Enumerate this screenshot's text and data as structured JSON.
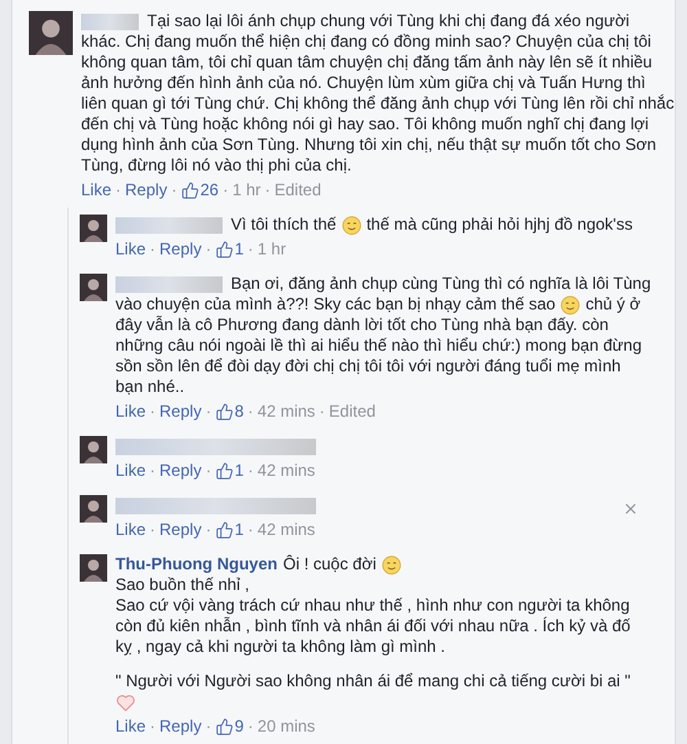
{
  "comment": {
    "lines": [
      [
        {
          "kind": "blur"
        },
        {
          "kind": "text",
          "text": "Tại sao lại lôi ánh chụp chung với Tùng khi chị đang đá xéo người"
        }
      ],
      [
        {
          "kind": "text",
          "text": "khác. Chị đang muốn thể hiện chị đang có đồng minh sao? Chuyện của chị tôi"
        }
      ],
      [
        {
          "kind": "text",
          "text": "không quan tâm, tôi chỉ quan tâm chuyện chị đăng tấm ảnh này lên sẽ ít nhiều"
        }
      ],
      [
        {
          "kind": "text",
          "text": "ảnh hưởng đến hình ảnh của nó. Chuyện lùm xùm giữa chị và Tuấn Hưng thì"
        }
      ],
      [
        {
          "kind": "text",
          "text": "liên quan gì tới Tùng chứ. Chị không thể đăng ảnh chụp với Tùng lên rồi chỉ nhắc"
        }
      ],
      [
        {
          "kind": "text",
          "text": "đến chị và Tùng hoặc không nói gì hay sao. Tôi không muốn nghĩ chị đang lợi"
        }
      ],
      [
        {
          "kind": "text",
          "text": "dụng hình ảnh của Sơn Tùng. Nhưng tôi xin chị, nếu thật sự muốn tốt cho Sơn"
        }
      ],
      [
        {
          "kind": "text",
          "text": "Tùng, đừng lôi nó vào thị phi của chị."
        }
      ]
    ],
    "footer": [
      {
        "kind": "link",
        "text": "Like"
      },
      {
        "kind": "sep",
        "text": "·"
      },
      {
        "kind": "link",
        "text": "Reply"
      },
      {
        "kind": "sep",
        "text": "·"
      },
      {
        "kind": "likes",
        "text": "26"
      },
      {
        "kind": "sep",
        "text": "·"
      },
      {
        "kind": "time",
        "text": "1 hr"
      },
      {
        "kind": "sep",
        "text": "·"
      },
      {
        "kind": "plain",
        "text": "Edited"
      }
    ]
  },
  "replies": [
    {
      "lines": [
        [
          {
            "kind": "blur"
          },
          {
            "kind": "text",
            "text": "Vì tôi thích thế"
          },
          {
            "kind": "emoji"
          },
          {
            "kind": "text",
            "text": "thế mà cũng phải hỏi hjhj đồ ngok'ss"
          }
        ]
      ],
      "footer": [
        {
          "kind": "link",
          "text": "Like"
        },
        {
          "kind": "sep",
          "text": "·"
        },
        {
          "kind": "link",
          "text": "Reply"
        },
        {
          "kind": "sep",
          "text": "·"
        },
        {
          "kind": "likes",
          "text": "1"
        },
        {
          "kind": "sep",
          "text": "·"
        },
        {
          "kind": "time",
          "text": "1 hr"
        }
      ]
    },
    {
      "lines": [
        [
          {
            "kind": "blur"
          },
          {
            "kind": "text",
            "text": "Bạn ơi, đăng ảnh chụp cùng Tùng thì có nghĩa là lôi Tùng"
          }
        ],
        [
          {
            "kind": "text",
            "text": "vào chuyện của mình à??! Sky các bạn bị nhạy cảm thế sao"
          },
          {
            "kind": "emoji"
          },
          {
            "kind": "text",
            "text": "chủ ý ở"
          }
        ],
        [
          {
            "kind": "text",
            "text": "đây vẫn là cô Phương đang dành lời tốt cho Tùng nhà bạn đấy. còn"
          }
        ],
        [
          {
            "kind": "text",
            "text": "những câu nói ngoài lề thì ai hiểu thế nào thì hiểu chứ:) mong bạn đừng"
          }
        ],
        [
          {
            "kind": "text",
            "text": "sồn sồn lên để đòi dạy đời chị chị tôi tôi với người đáng tuổi mẹ mình"
          }
        ],
        [
          {
            "kind": "text",
            "text": "bạn nhé.."
          }
        ]
      ],
      "footer": [
        {
          "kind": "link",
          "text": "Like"
        },
        {
          "kind": "sep",
          "text": "·"
        },
        {
          "kind": "link",
          "text": "Reply"
        },
        {
          "kind": "sep",
          "text": "·"
        },
        {
          "kind": "likes",
          "text": "8"
        },
        {
          "kind": "sep",
          "text": "·"
        },
        {
          "kind": "time",
          "text": "42 mins"
        },
        {
          "kind": "sep",
          "text": "·"
        },
        {
          "kind": "plain",
          "text": "Edited"
        }
      ]
    },
    {
      "footer": [
        {
          "kind": "link",
          "text": "Like"
        },
        {
          "kind": "sep",
          "text": "·"
        },
        {
          "kind": "link",
          "text": "Reply"
        },
        {
          "kind": "sep",
          "text": "·"
        },
        {
          "kind": "likes",
          "text": "1"
        },
        {
          "kind": "sep",
          "text": "·"
        },
        {
          "kind": "time",
          "text": "42 mins"
        }
      ]
    },
    {
      "closable": true,
      "footer": [
        {
          "kind": "link",
          "text": "Like"
        },
        {
          "kind": "sep",
          "text": "·"
        },
        {
          "kind": "link",
          "text": "Reply"
        },
        {
          "kind": "sep",
          "text": "·"
        },
        {
          "kind": "likes",
          "text": "1"
        },
        {
          "kind": "sep",
          "text": "·"
        },
        {
          "kind": "time",
          "text": "42 mins"
        }
      ]
    },
    {
      "lines": [
        [
          {
            "kind": "author",
            "text": "Thu-Phuong Nguyen"
          },
          {
            "kind": "text",
            "text": "Ôi ! cuộc đời"
          },
          {
            "kind": "emoji"
          }
        ],
        [
          {
            "kind": "text",
            "text": "Sao buồn thế nhỉ ,"
          }
        ],
        [
          {
            "kind": "text",
            "text": "Sao cứ vội vàng trách cứ nhau như thế , hình như con người ta không"
          }
        ],
        [
          {
            "kind": "text",
            "text": "còn đủ kiên nhẫn , bình tĩnh và nhân ái đối với nhau nữa . Ích kỷ và đố"
          }
        ],
        [
          {
            "kind": "text",
            "text": "kỵ , ngay cả khi người ta không làm gì mình ."
          }
        ],
        [
          {
            "kind": "gap"
          }
        ],
        [
          {
            "kind": "text",
            "text": "\" Người với Người sao không nhân ái để mang chi cả tiếng cười bi ai \""
          }
        ],
        [
          {
            "kind": "heart"
          }
        ]
      ],
      "footer": [
        {
          "kind": "link",
          "text": "Like"
        },
        {
          "kind": "sep",
          "text": "·"
        },
        {
          "kind": "link",
          "text": "Reply"
        },
        {
          "kind": "sep",
          "text": "·"
        },
        {
          "kind": "likes",
          "text": "9"
        },
        {
          "kind": "sep",
          "text": "·"
        },
        {
          "kind": "time",
          "text": "20 mins"
        }
      ]
    }
  ]
}
